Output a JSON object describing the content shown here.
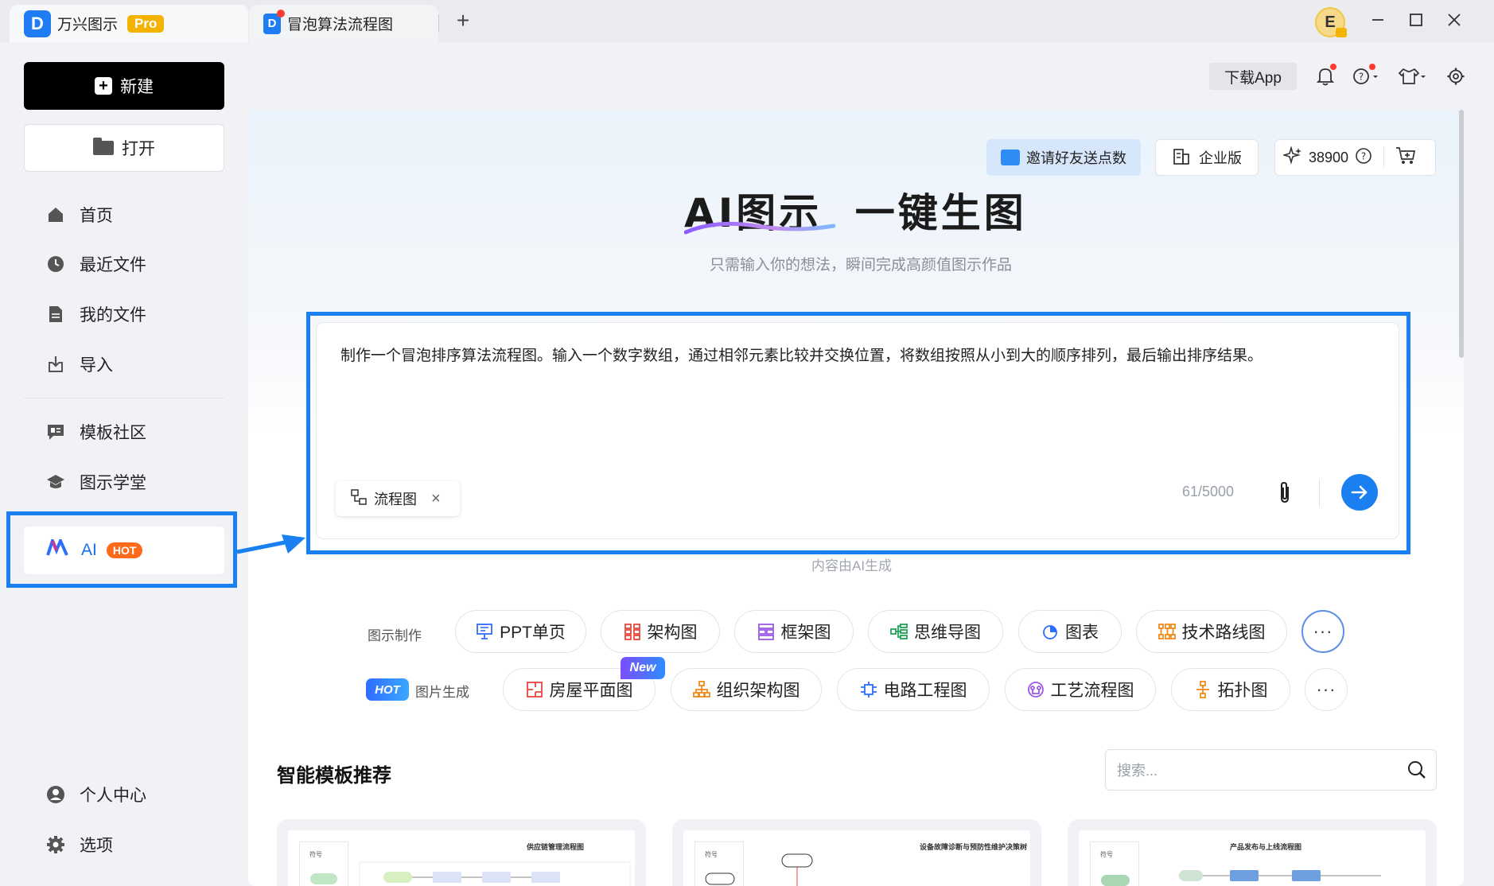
{
  "window": {
    "app_name": "万兴图示",
    "pro_badge": "Pro",
    "tabs": [
      {
        "label": "万兴图示"
      },
      {
        "label": "冒泡算法流程图"
      }
    ],
    "new_tab_symbol": "+",
    "avatar_initial": "E"
  },
  "sidebar": {
    "new_button": "新建",
    "open_button": "打开",
    "items": [
      {
        "label": "首页",
        "icon": "home-icon"
      },
      {
        "label": "最近文件",
        "icon": "clock-icon"
      },
      {
        "label": "我的文件",
        "icon": "file-icon"
      },
      {
        "label": "导入",
        "icon": "import-icon"
      },
      {
        "label": "模板社区",
        "icon": "community-icon"
      },
      {
        "label": "图示学堂",
        "icon": "graduation-cap-icon"
      }
    ],
    "ai_item": {
      "label": "AI",
      "badge": "HOT"
    },
    "bottom_items": [
      {
        "label": "个人中心",
        "icon": "user-icon"
      },
      {
        "label": "选项",
        "icon": "gear-icon"
      }
    ]
  },
  "topbar": {
    "download_app": "下载App"
  },
  "main": {
    "invite_button": "邀请好友送点数",
    "enterprise_button": "企业版",
    "points": "38900",
    "hero_title_prefix": "AI图示",
    "hero_title_suffix": "一键生图",
    "hero_subtitle": "只需输入你的想法，瞬间完成高颜值图示作品",
    "prompt_text": "制作一个冒泡排序算法流程图。输入一个数字数组，通过相邻元素比较并交换位置，将数组按照从小到大的顺序排列，最后输出排序结果。",
    "chip_label": "流程图",
    "counter": "61/5000",
    "ai_note": "内容由AI生成",
    "row1_label": "图示制作",
    "row1_items": [
      "PPT单页",
      "架构图",
      "框架图",
      "思维导图",
      "图表",
      "技术路线图"
    ],
    "row2_hot": "HOT",
    "row2_label": "图片生成",
    "row2_new": "New",
    "row2_items": [
      "房屋平面图",
      "组织架构图",
      "电路工程图",
      "工艺流程图",
      "拓扑图"
    ],
    "more_symbol": "···",
    "section_title": "智能模板推荐",
    "search_placeholder": "搜索...",
    "cards": [
      {
        "title": "供应链管理流程图",
        "col_label": "符号"
      },
      {
        "title": "设备故障诊断与预防性维护决策树",
        "col_label": "符号"
      },
      {
        "title": "产品发布与上线流程图",
        "col_label": "符号"
      }
    ]
  },
  "colors": {
    "accent": "#1a7ff0",
    "hot": "#ff6a1a",
    "pro": "#f5b301"
  }
}
